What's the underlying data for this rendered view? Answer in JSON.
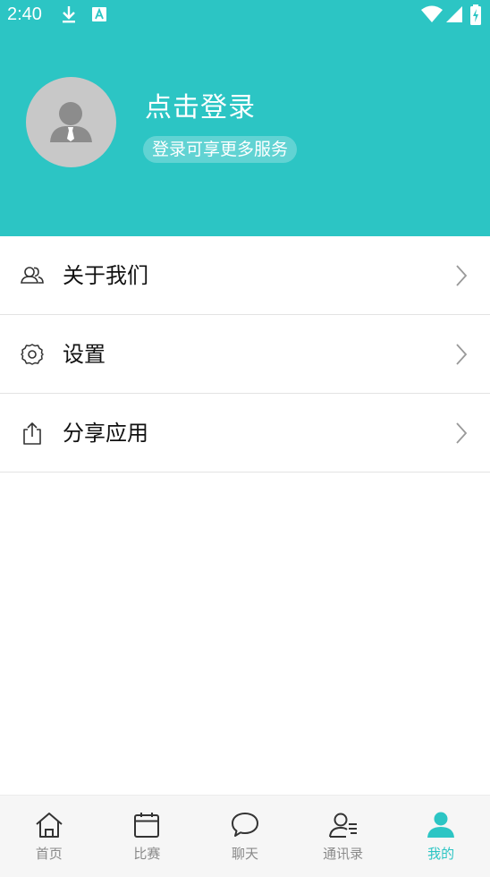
{
  "status_bar": {
    "time": "2:40"
  },
  "profile": {
    "login_title": "点击登录",
    "login_subtitle": "登录可享更多服务"
  },
  "menu": {
    "items": [
      {
        "label": "关于我们",
        "icon": "users-icon"
      },
      {
        "label": "设置",
        "icon": "gear-icon"
      },
      {
        "label": "分享应用",
        "icon": "share-icon"
      }
    ]
  },
  "bottom_nav": {
    "items": [
      {
        "label": "首页",
        "icon": "home-icon",
        "active": false
      },
      {
        "label": "比赛",
        "icon": "calendar-icon",
        "active": false
      },
      {
        "label": "聊天",
        "icon": "chat-icon",
        "active": false
      },
      {
        "label": "通讯录",
        "icon": "contacts-icon",
        "active": false
      },
      {
        "label": "我的",
        "icon": "person-icon",
        "active": true
      }
    ]
  },
  "colors": {
    "accent": "#2cc5c4",
    "inactive": "#8a8a8a",
    "avatar_bg": "#c8c8c8"
  }
}
